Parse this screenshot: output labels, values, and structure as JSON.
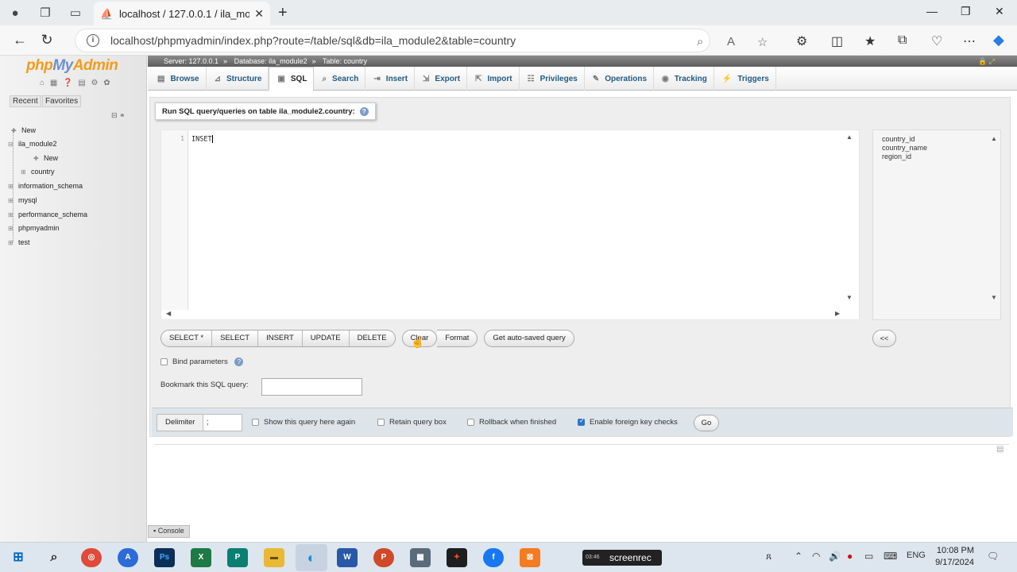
{
  "browser": {
    "tab_title": "localhost / 127.0.0.1 / ila_module2",
    "url": "localhost/phpmyadmin/index.php?route=/table/sql&db=ila_module2&table=country"
  },
  "navigation": {
    "logo_php": "php",
    "logo_my": "My",
    "logo_admin": "Admin",
    "tabs": [
      "Recent",
      "Favorites"
    ],
    "tree": {
      "new_root": "New",
      "db_active": "ila_module2",
      "new_child": "New",
      "table_country": "country",
      "databases": [
        "information_schema",
        "mysql",
        "performance_schema",
        "phpmyadmin",
        "test"
      ]
    }
  },
  "breadcrumb": {
    "server": "Server: 127.0.0.1",
    "database": "Database: ila_module2",
    "table": "Table: country"
  },
  "tabs": [
    "Browse",
    "Structure",
    "SQL",
    "Search",
    "Insert",
    "Export",
    "Import",
    "Privileges",
    "Operations",
    "Tracking",
    "Triggers"
  ],
  "active_tab": "SQL",
  "sql": {
    "heading": "Run SQL query/queries on table ila_module2.country:",
    "line_number": "1",
    "query": "INSET",
    "columns": [
      "country_id",
      "country_name",
      "region_id"
    ],
    "buttons_group": [
      "SELECT *",
      "SELECT",
      "INSERT",
      "UPDATE",
      "DELETE"
    ],
    "clear_label": "Clear",
    "format_label": "Format",
    "autosaved_label": "Get auto-saved query",
    "collapse_label": "<<",
    "bind_params_label": "Bind parameters",
    "bookmark_label": "Bookmark this SQL query:"
  },
  "footer": {
    "delimiter_label": "Delimiter",
    "delimiter_value": ";",
    "show_again": "Show this query here again",
    "retain_box": "Retain query box",
    "rollback": "Rollback when finished",
    "foreign_keys": "Enable foreign key checks",
    "foreign_keys_checked": true,
    "go_label": "Go"
  },
  "console_label": "Console",
  "taskbar": {
    "screenrec_label": "screenrec",
    "screenrec_time": "03:46",
    "lang": "ENG",
    "time": "10:08 PM",
    "date": "9/17/2024"
  },
  "colors": {
    "accent_blue": "#235a81",
    "logo_orange": "#f29c1b",
    "logo_blue": "#6c8fd0"
  }
}
